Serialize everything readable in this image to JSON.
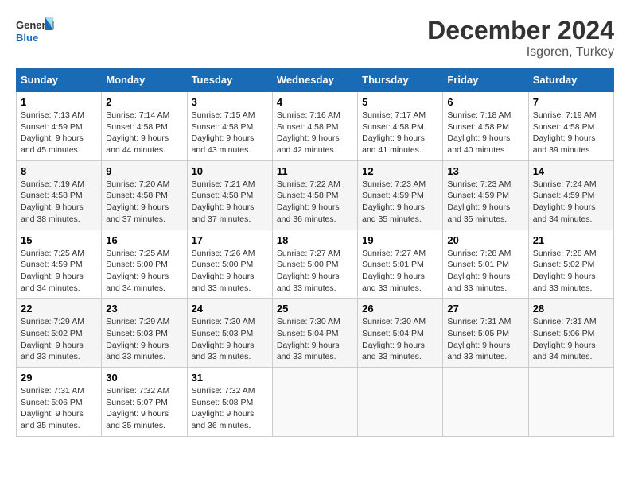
{
  "logo": {
    "line1": "General",
    "line2": "Blue"
  },
  "title": "December 2024",
  "location": "Isgoren, Turkey",
  "weekdays": [
    "Sunday",
    "Monday",
    "Tuesday",
    "Wednesday",
    "Thursday",
    "Friday",
    "Saturday"
  ],
  "weeks": [
    [
      {
        "day": "1",
        "sunrise": "7:13 AM",
        "sunset": "4:59 PM",
        "daylight": "9 hours and 45 minutes."
      },
      {
        "day": "2",
        "sunrise": "7:14 AM",
        "sunset": "4:58 PM",
        "daylight": "9 hours and 44 minutes."
      },
      {
        "day": "3",
        "sunrise": "7:15 AM",
        "sunset": "4:58 PM",
        "daylight": "9 hours and 43 minutes."
      },
      {
        "day": "4",
        "sunrise": "7:16 AM",
        "sunset": "4:58 PM",
        "daylight": "9 hours and 42 minutes."
      },
      {
        "day": "5",
        "sunrise": "7:17 AM",
        "sunset": "4:58 PM",
        "daylight": "9 hours and 41 minutes."
      },
      {
        "day": "6",
        "sunrise": "7:18 AM",
        "sunset": "4:58 PM",
        "daylight": "9 hours and 40 minutes."
      },
      {
        "day": "7",
        "sunrise": "7:19 AM",
        "sunset": "4:58 PM",
        "daylight": "9 hours and 39 minutes."
      }
    ],
    [
      {
        "day": "8",
        "sunrise": "7:19 AM",
        "sunset": "4:58 PM",
        "daylight": "9 hours and 38 minutes."
      },
      {
        "day": "9",
        "sunrise": "7:20 AM",
        "sunset": "4:58 PM",
        "daylight": "9 hours and 37 minutes."
      },
      {
        "day": "10",
        "sunrise": "7:21 AM",
        "sunset": "4:58 PM",
        "daylight": "9 hours and 37 minutes."
      },
      {
        "day": "11",
        "sunrise": "7:22 AM",
        "sunset": "4:58 PM",
        "daylight": "9 hours and 36 minutes."
      },
      {
        "day": "12",
        "sunrise": "7:23 AM",
        "sunset": "4:59 PM",
        "daylight": "9 hours and 35 minutes."
      },
      {
        "day": "13",
        "sunrise": "7:23 AM",
        "sunset": "4:59 PM",
        "daylight": "9 hours and 35 minutes."
      },
      {
        "day": "14",
        "sunrise": "7:24 AM",
        "sunset": "4:59 PM",
        "daylight": "9 hours and 34 minutes."
      }
    ],
    [
      {
        "day": "15",
        "sunrise": "7:25 AM",
        "sunset": "4:59 PM",
        "daylight": "9 hours and 34 minutes."
      },
      {
        "day": "16",
        "sunrise": "7:25 AM",
        "sunset": "5:00 PM",
        "daylight": "9 hours and 34 minutes."
      },
      {
        "day": "17",
        "sunrise": "7:26 AM",
        "sunset": "5:00 PM",
        "daylight": "9 hours and 33 minutes."
      },
      {
        "day": "18",
        "sunrise": "7:27 AM",
        "sunset": "5:00 PM",
        "daylight": "9 hours and 33 minutes."
      },
      {
        "day": "19",
        "sunrise": "7:27 AM",
        "sunset": "5:01 PM",
        "daylight": "9 hours and 33 minutes."
      },
      {
        "day": "20",
        "sunrise": "7:28 AM",
        "sunset": "5:01 PM",
        "daylight": "9 hours and 33 minutes."
      },
      {
        "day": "21",
        "sunrise": "7:28 AM",
        "sunset": "5:02 PM",
        "daylight": "9 hours and 33 minutes."
      }
    ],
    [
      {
        "day": "22",
        "sunrise": "7:29 AM",
        "sunset": "5:02 PM",
        "daylight": "9 hours and 33 minutes."
      },
      {
        "day": "23",
        "sunrise": "7:29 AM",
        "sunset": "5:03 PM",
        "daylight": "9 hours and 33 minutes."
      },
      {
        "day": "24",
        "sunrise": "7:30 AM",
        "sunset": "5:03 PM",
        "daylight": "9 hours and 33 minutes."
      },
      {
        "day": "25",
        "sunrise": "7:30 AM",
        "sunset": "5:04 PM",
        "daylight": "9 hours and 33 minutes."
      },
      {
        "day": "26",
        "sunrise": "7:30 AM",
        "sunset": "5:04 PM",
        "daylight": "9 hours and 33 minutes."
      },
      {
        "day": "27",
        "sunrise": "7:31 AM",
        "sunset": "5:05 PM",
        "daylight": "9 hours and 33 minutes."
      },
      {
        "day": "28",
        "sunrise": "7:31 AM",
        "sunset": "5:06 PM",
        "daylight": "9 hours and 34 minutes."
      }
    ],
    [
      {
        "day": "29",
        "sunrise": "7:31 AM",
        "sunset": "5:06 PM",
        "daylight": "9 hours and 35 minutes."
      },
      {
        "day": "30",
        "sunrise": "7:32 AM",
        "sunset": "5:07 PM",
        "daylight": "9 hours and 35 minutes."
      },
      {
        "day": "31",
        "sunrise": "7:32 AM",
        "sunset": "5:08 PM",
        "daylight": "9 hours and 36 minutes."
      },
      null,
      null,
      null,
      null
    ]
  ],
  "labels": {
    "sunrise": "Sunrise:",
    "sunset": "Sunset:",
    "daylight": "Daylight:"
  }
}
